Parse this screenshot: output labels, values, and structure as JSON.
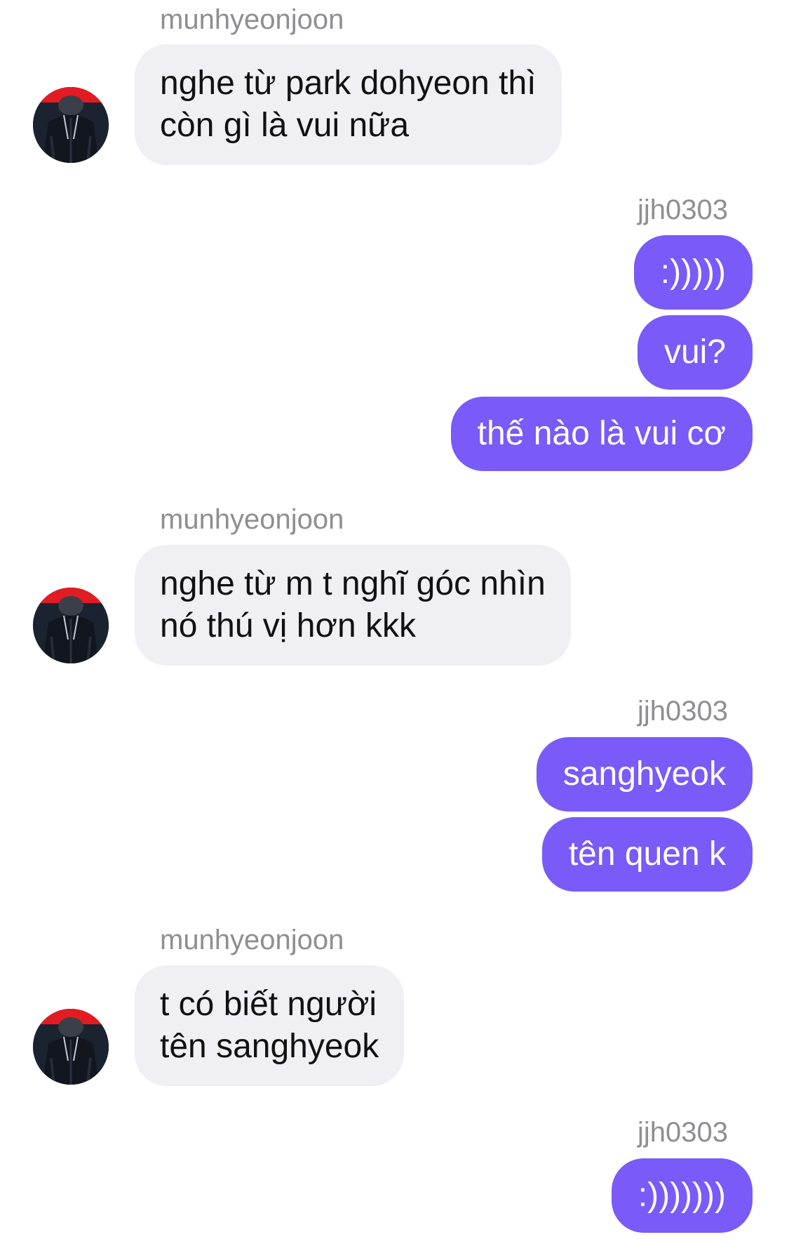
{
  "participants": {
    "other": "munhyeonjoon",
    "me": "jjh0303"
  },
  "colors": {
    "outgoing_bubble": "#7a5af8",
    "incoming_bubble": "#efeff4",
    "name_label": "#8e8e93"
  },
  "messages": [
    {
      "group": 1,
      "from": "munhyeonjoon",
      "lines": [
        "nghe từ park dohyeon thì",
        "còn gì là vui nữa"
      ]
    },
    {
      "group": 2,
      "from": "jjh0303",
      "text": ":)))))"
    },
    {
      "group": 2,
      "from": "jjh0303",
      "text": "vui?"
    },
    {
      "group": 2,
      "from": "jjh0303",
      "text": "thế nào là vui cơ"
    },
    {
      "group": 3,
      "from": "munhyeonjoon",
      "lines": [
        "nghe từ m t nghĩ góc nhìn",
        "nó thú vị hơn kkk"
      ]
    },
    {
      "group": 4,
      "from": "jjh0303",
      "text": "sanghyeok"
    },
    {
      "group": 4,
      "from": "jjh0303",
      "text": "tên quen k"
    },
    {
      "group": 5,
      "from": "munhyeonjoon",
      "lines": [
        "t có biết người",
        "tên sanghyeok"
      ]
    },
    {
      "group": 6,
      "from": "jjh0303",
      "text": ":)))))))"
    }
  ],
  "avatar_icon": "profile-photo-avatar"
}
